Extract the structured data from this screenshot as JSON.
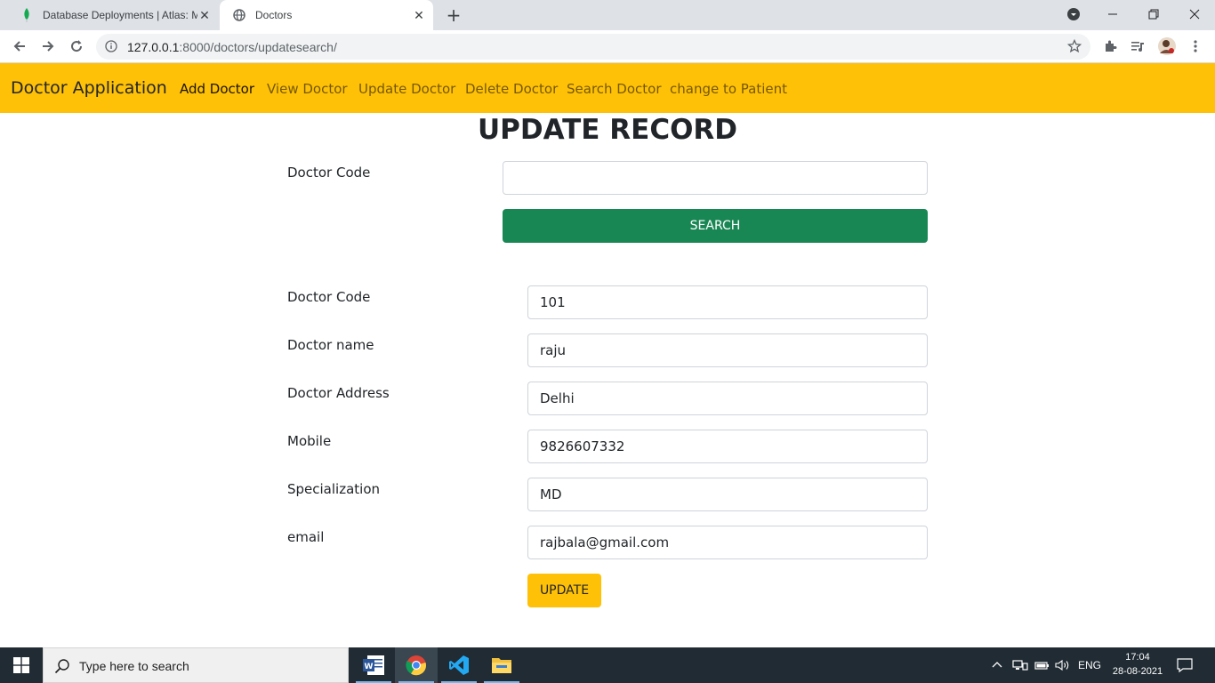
{
  "browser": {
    "tabs": [
      {
        "title": "Database Deployments | Atlas: M",
        "active": false,
        "icon": "mongodb-leaf-icon"
      },
      {
        "title": "Doctors",
        "active": true,
        "icon": "globe-icon"
      }
    ],
    "url_host": "127.0.0.1",
    "url_rest": ":8000/doctors/updatesearch/"
  },
  "navbar": {
    "brand": "Doctor Application",
    "links": [
      "Add Doctor",
      "View Doctor",
      "Update Doctor",
      "Delete Doctor",
      "Search Doctor",
      "change to Patient"
    ],
    "bg_color": "#ffc107"
  },
  "page": {
    "title": "UPDATE RECORD",
    "search": {
      "label": "Doctor Code",
      "value": "",
      "button": "SEARCH"
    },
    "form": {
      "fields": [
        {
          "label": "Doctor Code",
          "value": "101"
        },
        {
          "label": "Doctor name",
          "value": "raju"
        },
        {
          "label": "Doctor Address",
          "value": "Delhi"
        },
        {
          "label": "Mobile",
          "value": "9826607332"
        },
        {
          "label": "Specialization",
          "value": "MD"
        },
        {
          "label": "email",
          "value": "rajbala@gmail.com"
        }
      ],
      "button": "UPDATE"
    }
  },
  "taskbar": {
    "search_placeholder": "Type here to search",
    "language": "ENG",
    "time": "17:04",
    "date": "28-08-2021"
  }
}
